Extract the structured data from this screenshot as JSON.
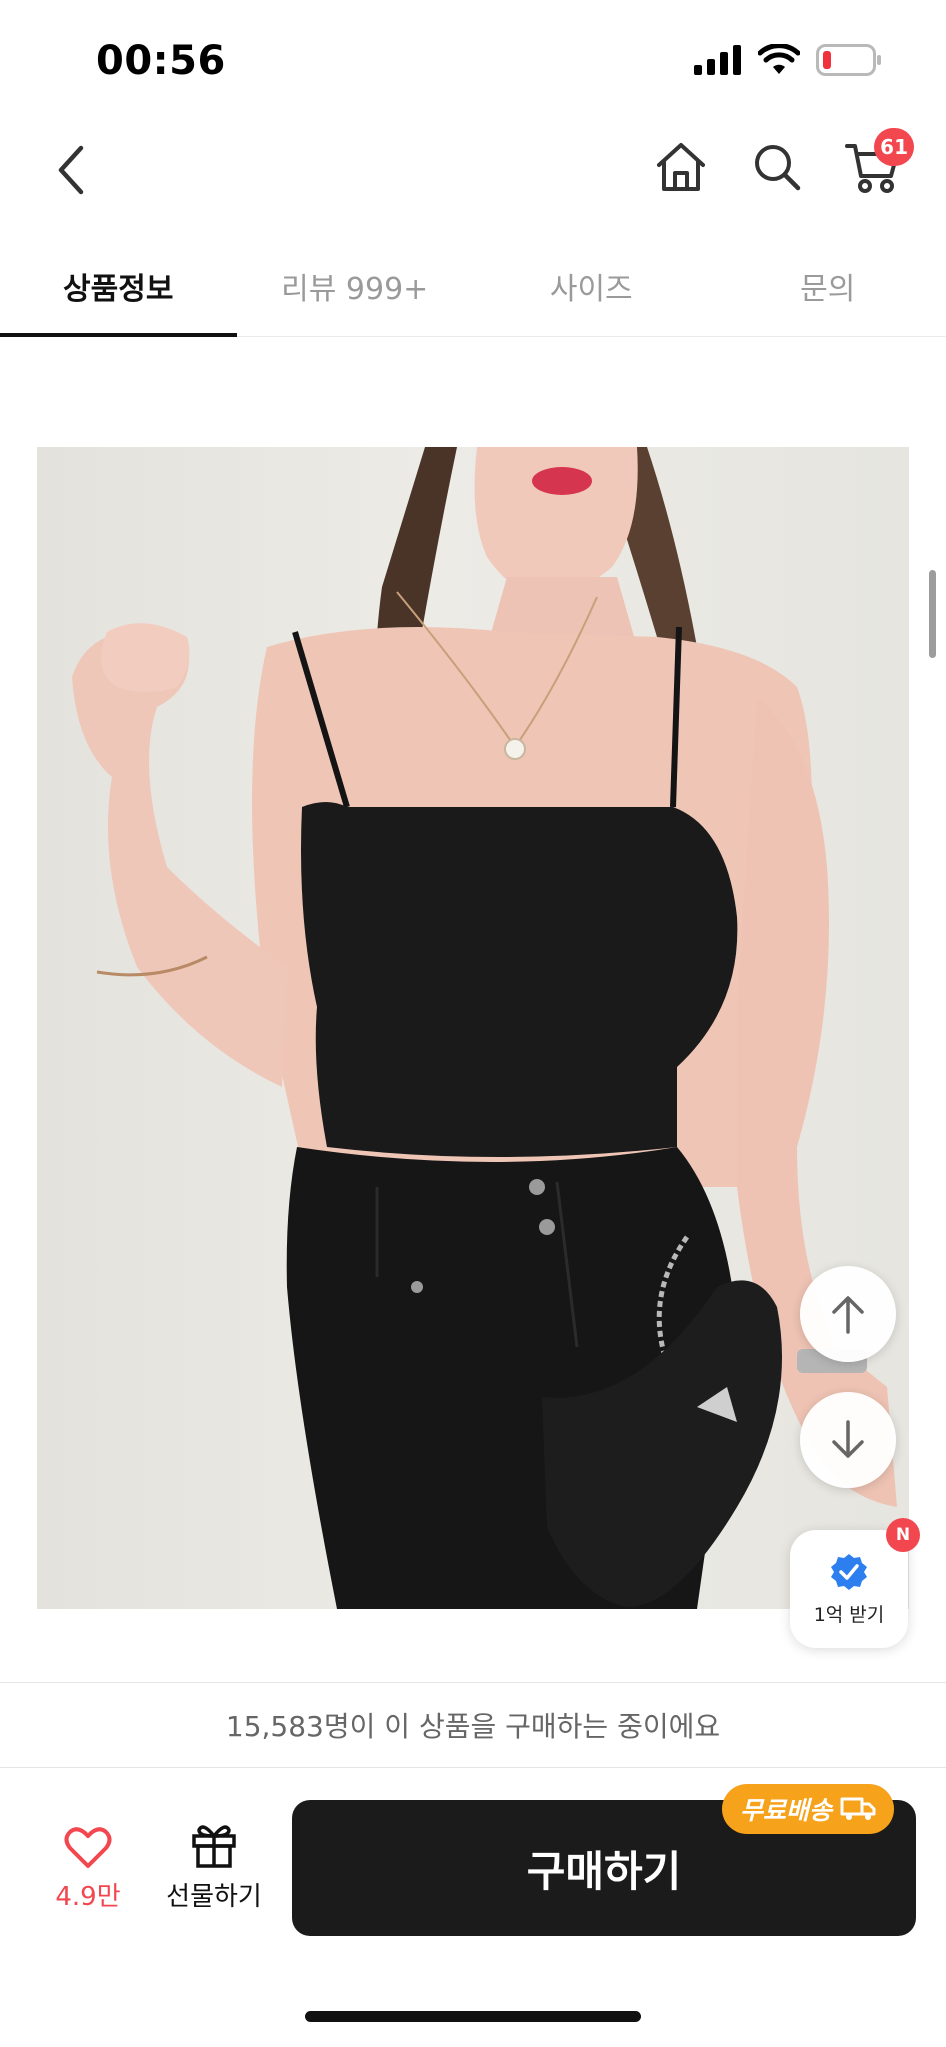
{
  "status_bar": {
    "time": "00:56"
  },
  "nav": {
    "cart_count": "61"
  },
  "tabs": [
    {
      "label": "상품정보",
      "active": true
    },
    {
      "label": "리뷰 999+",
      "active": false
    },
    {
      "label": "사이즈",
      "active": false
    },
    {
      "label": "문의",
      "active": false
    }
  ],
  "reward": {
    "label": "1억 받기",
    "badge": "N"
  },
  "info_bar": {
    "text": "15,583명이 이 상품을 구매하는 중이에요"
  },
  "actions": {
    "like_count": "4.9만",
    "gift_label": "선물하기",
    "buy_label": "구매하기",
    "free_shipping_label": "무료배송"
  },
  "colors": {
    "accent": "#f2474f",
    "shipping_badge": "#f7a21b",
    "buy_button": "#1b1b1b"
  },
  "icons": [
    "back-icon",
    "home-icon",
    "search-icon",
    "cart-icon",
    "heart-icon",
    "gift-icon",
    "arrow-up-icon",
    "arrow-down-icon",
    "verified-badge-icon",
    "truck-icon",
    "signal-icon",
    "wifi-icon",
    "battery-icon"
  ]
}
